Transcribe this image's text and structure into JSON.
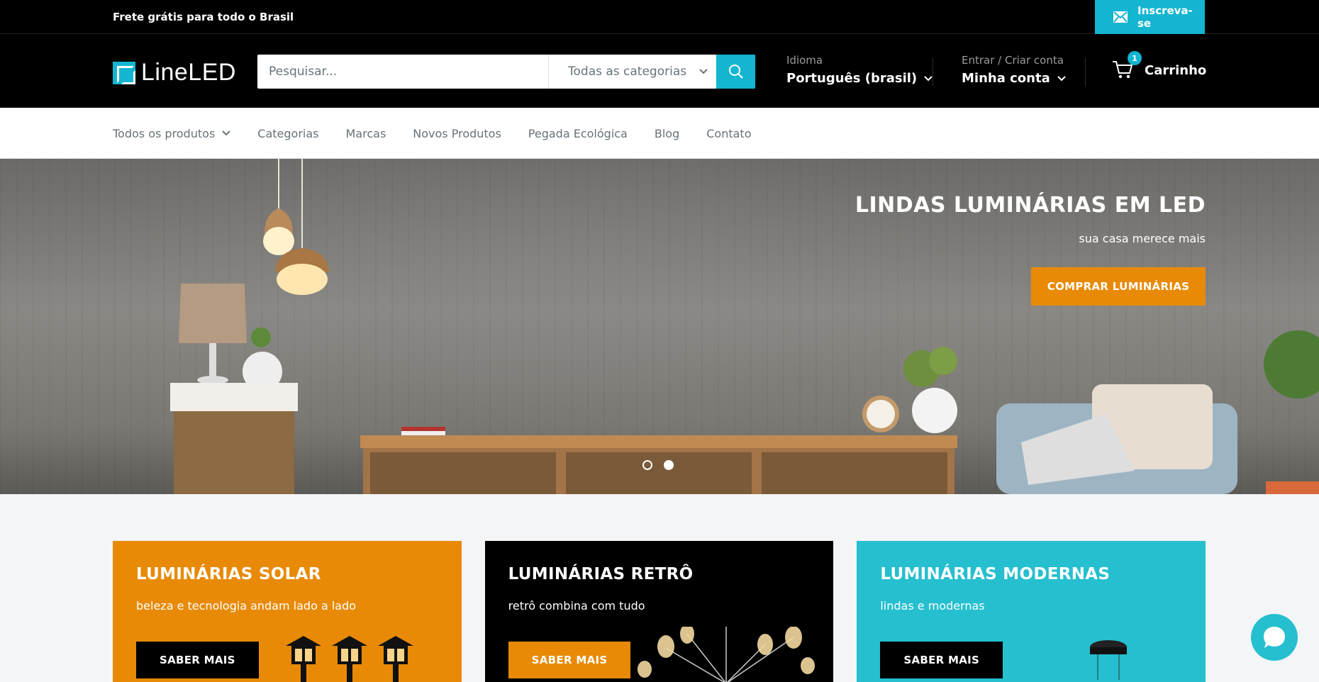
{
  "announcement": {
    "message": "Frete grátis para todo o Brasil",
    "subscribe_label": "Inscreva-se"
  },
  "header": {
    "logo_text": "LineLED",
    "search": {
      "placeholder": "Pesquisar...",
      "category_label": "Todas as categorias"
    },
    "language": {
      "caption": "Idioma",
      "value": "Português (brasil)"
    },
    "account": {
      "caption": "Entrar / Criar conta",
      "value": "Minha conta"
    },
    "cart": {
      "label": "Carrinho",
      "count": "1"
    }
  },
  "nav": {
    "items": [
      {
        "label": "Todos os produtos",
        "has_dropdown": true
      },
      {
        "label": "Categorias"
      },
      {
        "label": "Marcas"
      },
      {
        "label": "Novos Produtos"
      },
      {
        "label": "Pegada Ecológica"
      },
      {
        "label": "Blog"
      },
      {
        "label": "Contato"
      }
    ]
  },
  "hero": {
    "title": "LINDAS LUMINÁRIAS EM LED",
    "subtitle": "sua casa merece mais",
    "cta_label": "COMPRAR LUMINÁRIAS",
    "slides_total": 2,
    "active_slide": 2
  },
  "collections": [
    {
      "title": "LUMINÁRIAS SOLAR",
      "text": "beleza e tecnologia andam lado a lado",
      "button": "SABER MAIS",
      "color": "#e88a06"
    },
    {
      "title": "LUMINÁRIAS RETRÔ",
      "text": "retrô combina com tudo",
      "button": "SABER MAIS",
      "color": "#000000"
    },
    {
      "title": "LUMINÁRIAS MODERNAS",
      "text": "lindas e modernas",
      "button": "SABER MAIS",
      "color": "#25bfcf"
    }
  ],
  "colors": {
    "accent": "#13b5d1",
    "orange": "#e88a06",
    "header_bg": "#000000"
  }
}
